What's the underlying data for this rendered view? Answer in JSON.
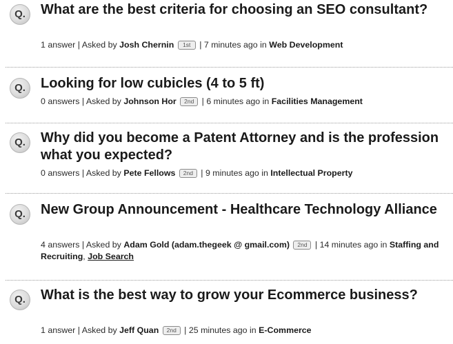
{
  "q_icon_text": "Q.",
  "questions": [
    {
      "title": "What are the best criteria for choosing an SEO consultant?",
      "answers": "1 answer",
      "asked_by_prefix": "Asked by",
      "author": "Josh Chernin",
      "degree": "1st",
      "time": "7 minutes ago",
      "in_text": "in",
      "category": "Web Development"
    },
    {
      "title": "Looking for low cubicles (4 to 5 ft)",
      "answers": "0 answers",
      "asked_by_prefix": "Asked by",
      "author": "Johnson Hor",
      "degree": "2nd",
      "time": "6 minutes ago",
      "in_text": "in",
      "category": "Facilities Management"
    },
    {
      "title": "Why did you become a Patent Attorney and is the profession what you expected?",
      "answers": "0 answers",
      "asked_by_prefix": "Asked by",
      "author": "Pete Fellows",
      "degree": "2nd",
      "time": "9 minutes ago",
      "in_text": "in",
      "category": "Intellectual Property"
    },
    {
      "title": "New Group Announcement - Healthcare Technology Alliance",
      "answers": "4 answers",
      "asked_by_prefix": "Asked by",
      "author": "Adam Gold (adam.thegeek @ gmail.com)",
      "degree": "2nd",
      "time": "14 minutes ago",
      "in_text": "in",
      "category": "Staffing and Recruiting",
      "category_separator": ",",
      "category2": "Job Search"
    },
    {
      "title": "What is the best way to grow your Ecommerce business?",
      "answers": "1 answer",
      "asked_by_prefix": "Asked by",
      "author": "Jeff Quan",
      "degree": "2nd",
      "time": "25 minutes ago",
      "in_text": "in",
      "category": "E-Commerce"
    }
  ]
}
